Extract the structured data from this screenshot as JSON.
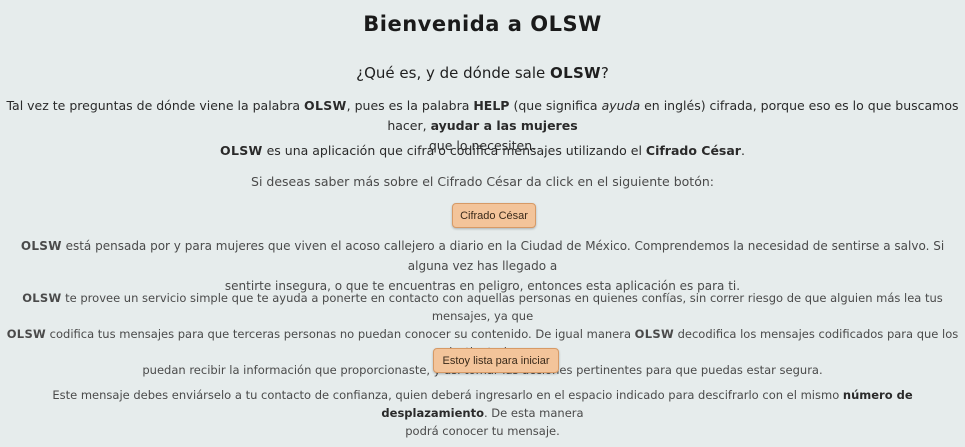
{
  "page": {
    "title": "Bienvenida a OLSW",
    "subtitle_pre": "¿Qué es, y de dónde sale ",
    "subtitle_brand": "OLSW",
    "subtitle_post": "?"
  },
  "intro": {
    "p1_a": "Tal vez te preguntas de dónde viene la palabra ",
    "p1_brand": "OLSW",
    "p1_b": ", pues es la palabra ",
    "p1_help": "HELP",
    "p1_c": " (que significa ",
    "p1_ayuda": "ayuda",
    "p1_d": " en inglés) cifrada, porque eso es lo que buscamos hacer, ",
    "p1_strong": "ayudar a las mujeres",
    "p1_line2": "que lo necesiten.",
    "p2_brand": "OLSW",
    "p2_a": " es una aplicación que cifra o codifica mensajes utilizando el ",
    "p2_strong": "Cifrado César",
    "p2_b": ".",
    "p3": "Si deseas saber más sobre el Cifrado César da click en el siguiente botón:"
  },
  "buttons": {
    "cifrado_cesar": "Cifrado César",
    "start": "Estoy lista para iniciar"
  },
  "about": {
    "p4_brand": "OLSW",
    "p4_line1": " está pensada por y para mujeres que viven el acoso callejero a diario en la Ciudad de México. Comprendemos la necesidad de sentirse a salvo. Si alguna vez has llegado a",
    "p4_line2": "sentirte insegura, o que te encuentras en peligro, entonces esta aplicación es para ti.",
    "p5_brand": "OLSW",
    "p5_line1": " te provee un servicio simple que te ayuda a ponerte en contacto con aquellas personas en quienes confías, sin correr riesgo de que alguien más lea tus mensajes, ya que",
    "p5_brand2": "OLSW",
    "p5_line2a": " codifica tus mensajes para que terceras personas no puedan conocer su contenido. De igual manera ",
    "p5_brand3": "OLSW",
    "p5_line2b": " decodifica los mensajes codificados para que los destinatarios",
    "p5_line3": "puedan recibir la información que proporcionaste, y así tomar las acciones pertinentes para que puedas estar segura."
  },
  "footer": {
    "p6_a": "Este mensaje debes enviárselo a tu contacto de confianza, quien deberá ingresarlo en el espacio indicado para descifrarlo con el mismo ",
    "p6_strong": "número de desplazamiento",
    "p6_b": ". De esta manera",
    "p6_line2": "podrá conocer tu mensaje."
  },
  "colors": {
    "background": "#e6ecec",
    "button": "#f3c49a",
    "text": "#2c2c2c"
  }
}
